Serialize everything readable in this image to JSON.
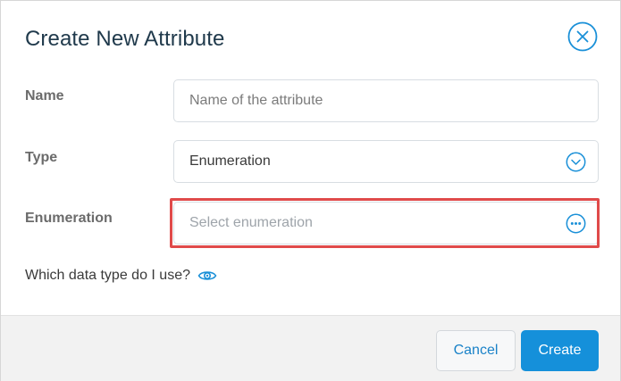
{
  "dialog": {
    "title": "Create New Attribute"
  },
  "form": {
    "name": {
      "label": "Name",
      "placeholder": "Name of the attribute",
      "value": ""
    },
    "type": {
      "label": "Type",
      "value": "Enumeration"
    },
    "enumeration": {
      "label": "Enumeration",
      "placeholder": "Select enumeration",
      "value": ""
    }
  },
  "help": {
    "text": "Which data type do I use?",
    "icon": "eye-icon"
  },
  "footer": {
    "cancel_label": "Cancel",
    "create_label": "Create"
  },
  "colors": {
    "accent": "#1590da",
    "highlight": "#e04a4a",
    "title": "#203a4c"
  }
}
